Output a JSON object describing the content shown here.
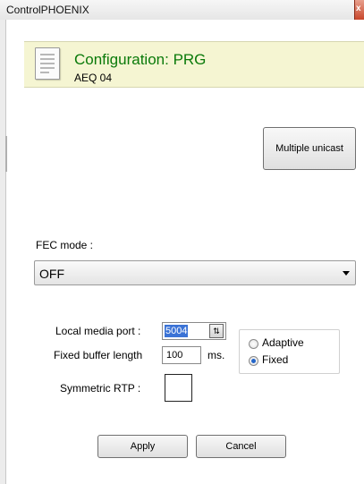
{
  "window": {
    "title": "ControlPHOENIX",
    "close_glyph": "x"
  },
  "header_panel": {
    "title": "Configuration: PRG",
    "subtitle": "AEQ 04",
    "icon": "document-icon"
  },
  "buttons": {
    "multiple_unicast": "Multiple unicast",
    "apply": "Apply",
    "cancel": "Cancel"
  },
  "fec": {
    "label": "FEC mode :",
    "selected": "OFF"
  },
  "local_media_port": {
    "label": "Local media port :",
    "value": "5004",
    "spin_glyph": "⇅"
  },
  "fixed_buffer": {
    "label": "Fixed buffer length",
    "value": "100",
    "unit": "ms."
  },
  "buffer_mode": {
    "options": [
      "Adaptive",
      "Fixed"
    ],
    "selected": "Fixed"
  },
  "symmetric_rtp": {
    "label": "Symmetric RTP :",
    "checked": false
  },
  "colors": {
    "title_green": "#0a7a0a",
    "panel_bg": "#f5f5d2",
    "selection_blue": "#3b73d6"
  }
}
